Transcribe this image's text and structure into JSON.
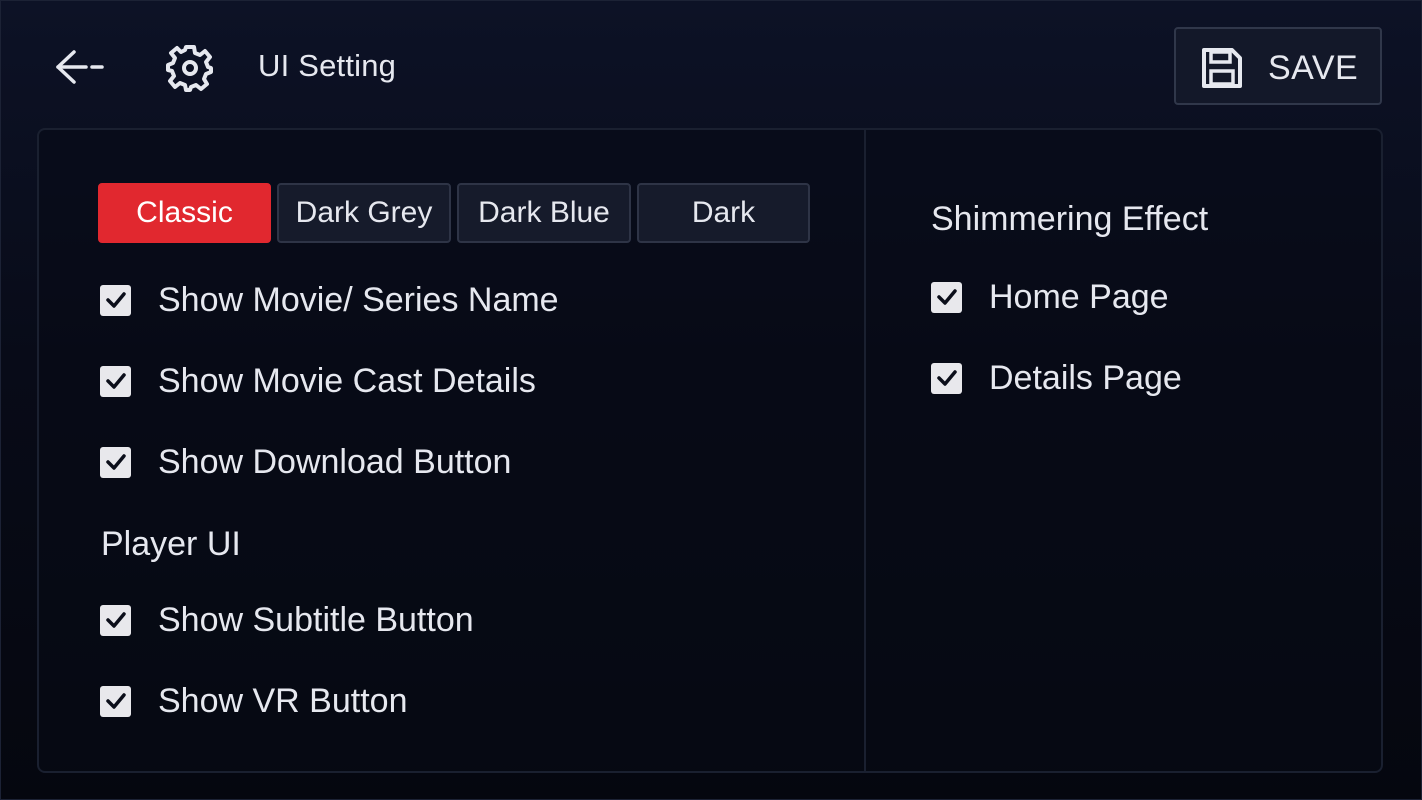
{
  "header": {
    "back_icon": "arrow-left-icon",
    "settings_icon": "gear-icon",
    "title": "UI Setting",
    "save_icon": "floppy-disk-icon",
    "save_label": "SAVE"
  },
  "themes": {
    "options": [
      "Classic",
      "Dark Grey",
      "Dark Blue",
      "Dark"
    ],
    "selected": "Classic",
    "accent_color": "#e1282f"
  },
  "display_options": [
    {
      "label": "Show Movie/ Series Name",
      "checked": true
    },
    {
      "label": "Show Movie Cast Details",
      "checked": true
    },
    {
      "label": "Show Download Button",
      "checked": true
    }
  ],
  "player_ui": {
    "heading": "Player UI",
    "options": [
      {
        "label": "Show Subtitle Button",
        "checked": true
      },
      {
        "label": "Show VR Button",
        "checked": true
      }
    ]
  },
  "shimmering": {
    "heading": "Shimmering Effect",
    "options": [
      {
        "label": "Home Page",
        "checked": true
      },
      {
        "label": "Details Page",
        "checked": true
      }
    ]
  }
}
